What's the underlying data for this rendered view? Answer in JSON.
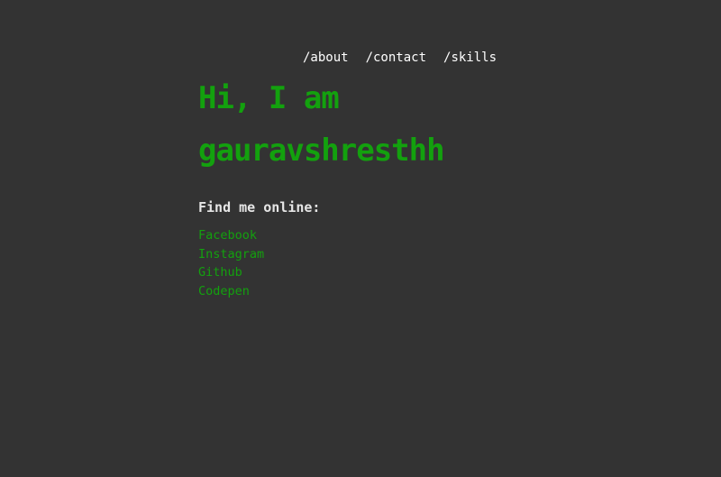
{
  "nav": {
    "items": [
      "/about",
      "/contact",
      "/skills"
    ]
  },
  "hero": {
    "line1": "Hi, I am",
    "line2": "gauravshresthh"
  },
  "social": {
    "heading": "Find me online:",
    "links": [
      "Facebook",
      "Instagram",
      "Github",
      "Codepen"
    ]
  },
  "colors": {
    "background": "#333333",
    "accent": "#13a10e",
    "nav_text": "#ffffff",
    "heading_text": "#e6e6e6"
  }
}
